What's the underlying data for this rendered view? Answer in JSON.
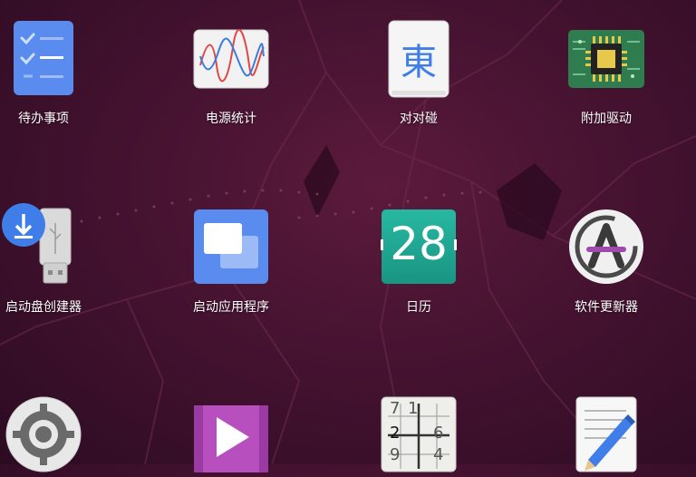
{
  "apps": [
    {
      "name": "待办事项",
      "icon": "todo-checklist-icon"
    },
    {
      "name": "电源统计",
      "icon": "power-statistics-icon"
    },
    {
      "name": "对对碰",
      "icon": "mahjongg-tile-icon",
      "glyph": "東"
    },
    {
      "name": "附加驱动",
      "icon": "additional-drivers-chip-icon"
    },
    {
      "name": "启动盘创建器",
      "icon": "startup-disk-creator-icon"
    },
    {
      "name": "启动应用程序",
      "icon": "startup-applications-icon"
    },
    {
      "name": "日历",
      "icon": "calendar-icon",
      "day": "28"
    },
    {
      "name": "软件更新器",
      "icon": "software-updater-icon",
      "letter": "A"
    },
    {
      "name": "",
      "icon": "settings-gear-icon"
    },
    {
      "name": "",
      "icon": "video-player-icon"
    },
    {
      "name": "",
      "icon": "sudoku-icon",
      "digits": [
        "7",
        "1",
        "2",
        "6",
        "9",
        "4"
      ]
    },
    {
      "name": "",
      "icon": "text-editor-pencil-icon"
    }
  ],
  "colors": {
    "todo_blue": "#5a8cf0",
    "calendar_teal": "#1fa894",
    "chip_green": "#2f7d4f",
    "startup_blue": "#5a8cf0",
    "video_purple": "#b84fbf",
    "accent_blue": "#3f7ee8"
  }
}
